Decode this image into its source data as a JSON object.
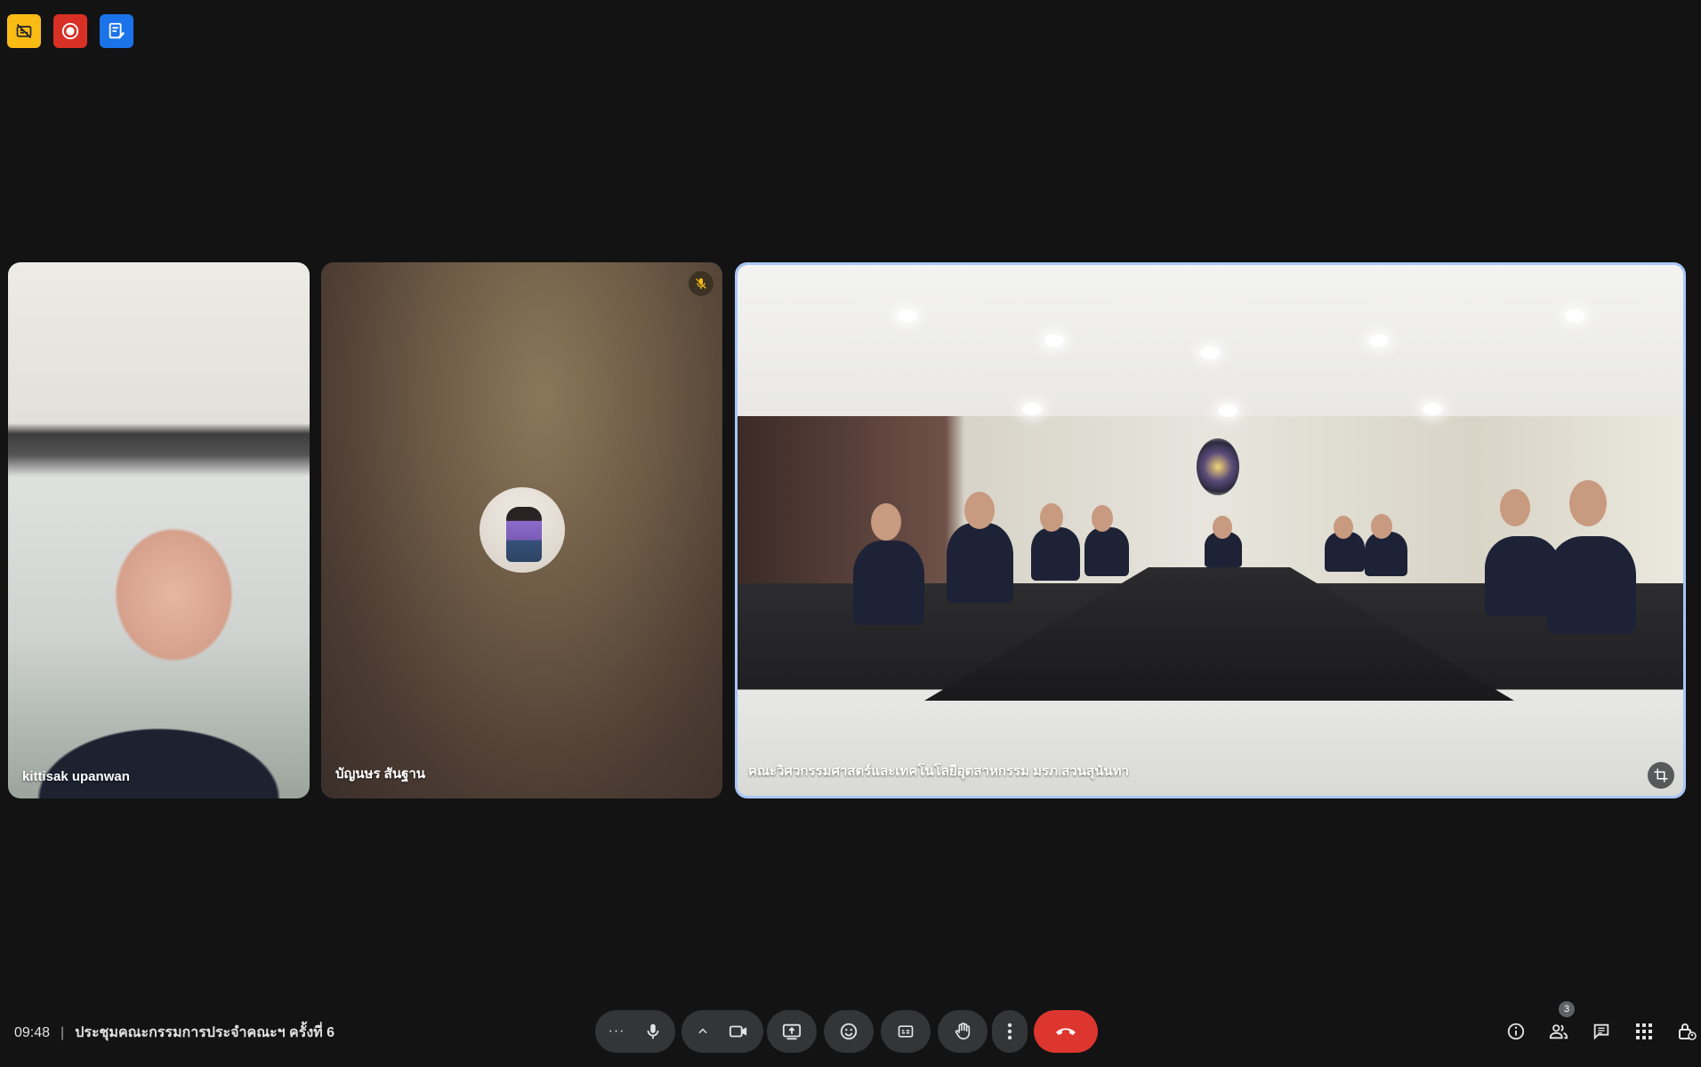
{
  "colors": {
    "background": "#131314",
    "control_bg": "#333537",
    "end_call": "#dc362e",
    "active_speaker_border": "#a8c7fa",
    "indicator_yellow": "#f9bb14",
    "indicator_red": "#d93025",
    "indicator_blue": "#1a73e8"
  },
  "indicators": [
    {
      "icon": "captions-off-icon"
    },
    {
      "icon": "recording-icon"
    },
    {
      "icon": "notes-icon"
    }
  ],
  "tiles": [
    {
      "name": "kittisak upanwan",
      "muted": false,
      "type": "video"
    },
    {
      "name": "บัญนษร สันฐาน",
      "muted": true,
      "type": "avatar"
    },
    {
      "name": "คณะวิศวกรรมศาสตร์และเทคโนโลยีอุตสาหกรรม มรภ.สวนสุนันทา",
      "muted": false,
      "type": "video",
      "active_speaker": true
    }
  ],
  "meeting": {
    "time": "09:48",
    "separator": "|",
    "title": "ประชุมคณะกรรมการประจำคณะฯ ครั้งที่ 6"
  },
  "controls": [
    {
      "icon": "more-options-icon",
      "text": "···"
    },
    {
      "icon": "microphone-icon"
    },
    {
      "icon": "chevron-up-icon"
    },
    {
      "icon": "camera-icon"
    },
    {
      "icon": "present-screen-icon"
    },
    {
      "icon": "emoji-icon"
    },
    {
      "icon": "captions-icon"
    },
    {
      "icon": "raise-hand-icon"
    },
    {
      "icon": "more-vert-icon"
    },
    {
      "icon": "end-call-icon"
    }
  ],
  "right_panel": {
    "participant_count": "3",
    "icons": [
      "info-icon",
      "people-icon",
      "chat-icon",
      "activities-icon",
      "host-controls-icon"
    ]
  }
}
